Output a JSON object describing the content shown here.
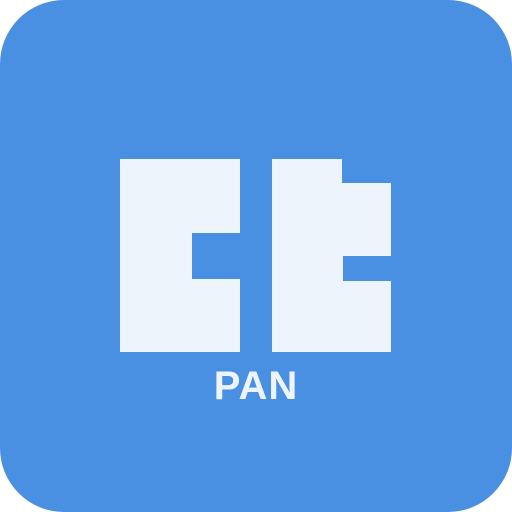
{
  "icon": {
    "name": "PAN",
    "colors": {
      "background": "#4a90e2",
      "foreground": "#eef4fc"
    }
  }
}
